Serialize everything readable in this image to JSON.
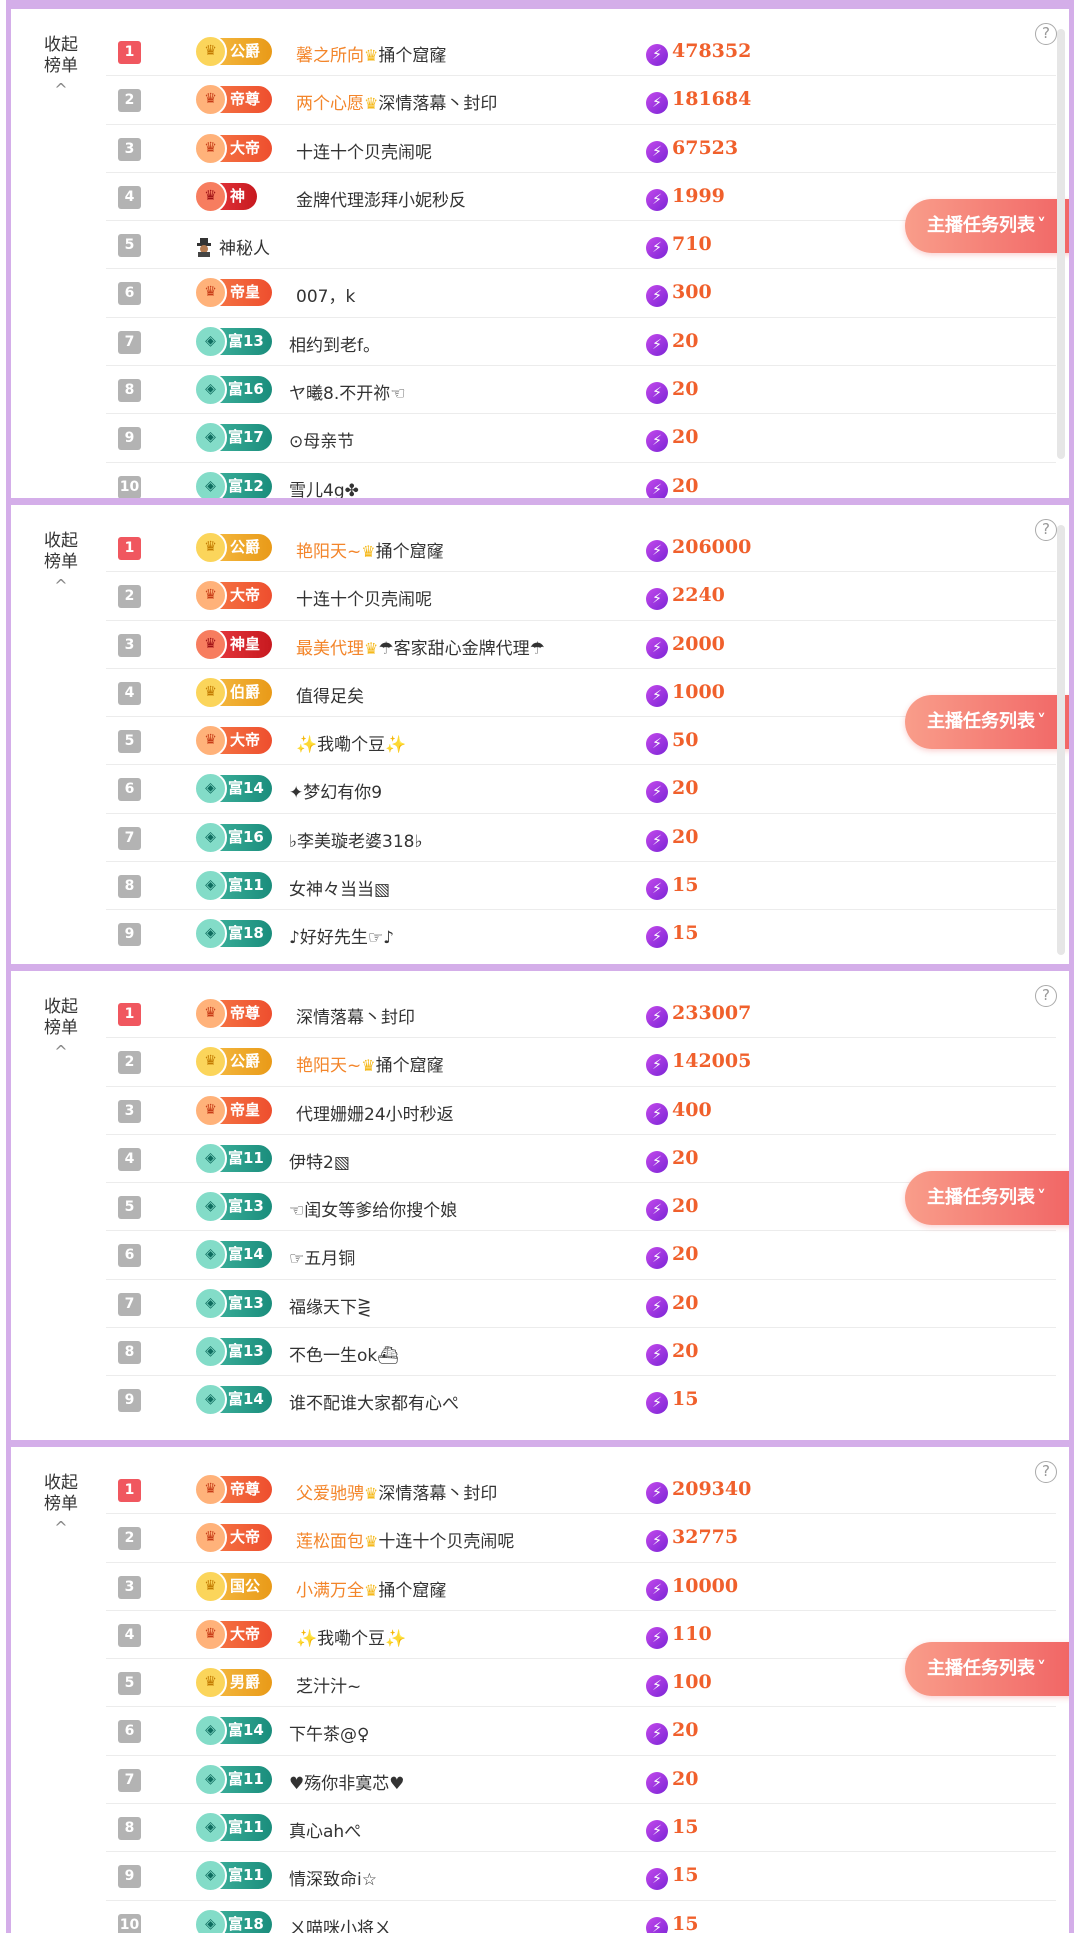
{
  "ui": {
    "collapse_label_1": "收起",
    "collapse_label_2": "榜单",
    "help_glyph": "?",
    "task_button_label": "主播任务列表"
  },
  "panels": [
    {
      "rows": [
        {
          "rank": "1",
          "badge": "公爵",
          "tier": "gold",
          "prefix": "馨之所向",
          "name": "捅个窟窿",
          "score": "478352"
        },
        {
          "rank": "2",
          "badge": "帝尊",
          "tier": "orange",
          "prefix": "两个心愿",
          "name": "深情落幕丶封印",
          "score": "181684"
        },
        {
          "rank": "3",
          "badge": "大帝",
          "tier": "orange",
          "prefix": "",
          "name": "十连十个贝壳闹呢",
          "score": "67523"
        },
        {
          "rank": "4",
          "badge": "神",
          "tier": "red",
          "prefix": "",
          "name": "金牌代理澎拜小妮秒反",
          "score": "1999"
        },
        {
          "rank": "5",
          "badge": "",
          "tier": "spy",
          "prefix": "",
          "name": "神秘人",
          "score": "710"
        },
        {
          "rank": "6",
          "badge": "帝皇",
          "tier": "orange",
          "prefix": "",
          "name": "007，k",
          "score": "300"
        },
        {
          "rank": "7",
          "badge": "富13",
          "tier": "green",
          "prefix": "",
          "name": "相约到老f。",
          "score": "20"
        },
        {
          "rank": "8",
          "badge": "富16",
          "tier": "green",
          "prefix": "",
          "name": "ヤ曦8.不开祢☜",
          "score": "20"
        },
        {
          "rank": "9",
          "badge": "富17",
          "tier": "green",
          "prefix": "",
          "name": "⊙母亲节",
          "score": "20"
        },
        {
          "rank": "10",
          "badge": "富12",
          "tier": "green",
          "prefix": "",
          "name": "雪儿4g✤",
          "score": "20"
        }
      ]
    },
    {
      "rows": [
        {
          "rank": "1",
          "badge": "公爵",
          "tier": "gold",
          "prefix": "艳阳天~",
          "name": "捅个窟窿",
          "score": "206000"
        },
        {
          "rank": "2",
          "badge": "大帝",
          "tier": "orange",
          "prefix": "",
          "name": "十连十个贝壳闹呢",
          "score": "2240"
        },
        {
          "rank": "3",
          "badge": "神皇",
          "tier": "red",
          "prefix": "最美代理",
          "name": "☂客家甜心金牌代理☂",
          "score": "2000"
        },
        {
          "rank": "4",
          "badge": "伯爵",
          "tier": "gold",
          "prefix": "",
          "name": "值得足矣",
          "score": "1000"
        },
        {
          "rank": "5",
          "badge": "大帝",
          "tier": "orange",
          "prefix": "",
          "name": "✨我嘞个豆✨",
          "score": "50"
        },
        {
          "rank": "6",
          "badge": "富14",
          "tier": "green",
          "prefix": "",
          "name": "✦梦幻有你9",
          "score": "20"
        },
        {
          "rank": "7",
          "badge": "富16",
          "tier": "green",
          "prefix": "",
          "name": "♭李美璇老婆318♭",
          "score": "20"
        },
        {
          "rank": "8",
          "badge": "富11",
          "tier": "green",
          "prefix": "",
          "name": "女神々当当▧",
          "score": "15"
        },
        {
          "rank": "9",
          "badge": "富18",
          "tier": "green",
          "prefix": "",
          "name": "♪好好先生☞♪",
          "score": "15"
        }
      ]
    },
    {
      "rows": [
        {
          "rank": "1",
          "badge": "帝尊",
          "tier": "orange",
          "prefix": "",
          "name": "深情落幕丶封印",
          "score": "233007"
        },
        {
          "rank": "2",
          "badge": "公爵",
          "tier": "gold",
          "prefix": "艳阳天~",
          "name": "捅个窟窿",
          "score": "142005"
        },
        {
          "rank": "3",
          "badge": "帝皇",
          "tier": "orange",
          "prefix": "",
          "name": "代理姗姗24小时秒返",
          "score": "400"
        },
        {
          "rank": "4",
          "badge": "富11",
          "tier": "green",
          "prefix": "",
          "name": "伊特2▧",
          "score": "20"
        },
        {
          "rank": "5",
          "badge": "富13",
          "tier": "green",
          "prefix": "",
          "name": "☜闺女等爹给你搜个娘",
          "score": "20"
        },
        {
          "rank": "6",
          "badge": "富14",
          "tier": "green",
          "prefix": "",
          "name": "☞五月铜",
          "score": "20"
        },
        {
          "rank": "7",
          "badge": "富13",
          "tier": "green",
          "prefix": "",
          "name": "福缘天下⋛",
          "score": "20"
        },
        {
          "rank": "8",
          "badge": "富13",
          "tier": "green",
          "prefix": "",
          "name": "不色一生ok⛴",
          "score": "20"
        },
        {
          "rank": "9",
          "badge": "富14",
          "tier": "green",
          "prefix": "",
          "name": "谁不配谁大家都有心ぺ",
          "score": "15"
        }
      ]
    },
    {
      "rows": [
        {
          "rank": "1",
          "badge": "帝尊",
          "tier": "orange",
          "prefix": "父爱驰骋",
          "name": "深情落幕丶封印",
          "score": "209340"
        },
        {
          "rank": "2",
          "badge": "大帝",
          "tier": "orange",
          "prefix": "莲松面包",
          "name": "十连十个贝壳闹呢",
          "score": "32775"
        },
        {
          "rank": "3",
          "badge": "国公",
          "tier": "gold",
          "prefix": "小满万全",
          "name": "捅个窟窿",
          "score": "10000"
        },
        {
          "rank": "4",
          "badge": "大帝",
          "tier": "orange",
          "prefix": "",
          "name": "✨我嘞个豆✨",
          "score": "110"
        },
        {
          "rank": "5",
          "badge": "男爵",
          "tier": "gold",
          "prefix": "",
          "name": "芝汁汁~",
          "score": "100"
        },
        {
          "rank": "6",
          "badge": "富14",
          "tier": "green",
          "prefix": "",
          "name": "下午茶@♀",
          "score": "20"
        },
        {
          "rank": "7",
          "badge": "富11",
          "tier": "green",
          "prefix": "",
          "name": "♥殇你非寞芯♥",
          "score": "20"
        },
        {
          "rank": "8",
          "badge": "富11",
          "tier": "green",
          "prefix": "",
          "name": "真心ahぺ",
          "score": "15"
        },
        {
          "rank": "9",
          "badge": "富11",
          "tier": "green",
          "prefix": "",
          "name": "情深致命i☆",
          "score": "15"
        },
        {
          "rank": "10",
          "badge": "富18",
          "tier": "green",
          "prefix": "",
          "name": "ㄨ喵咪小将ㄨ",
          "score": "15"
        }
      ]
    }
  ]
}
